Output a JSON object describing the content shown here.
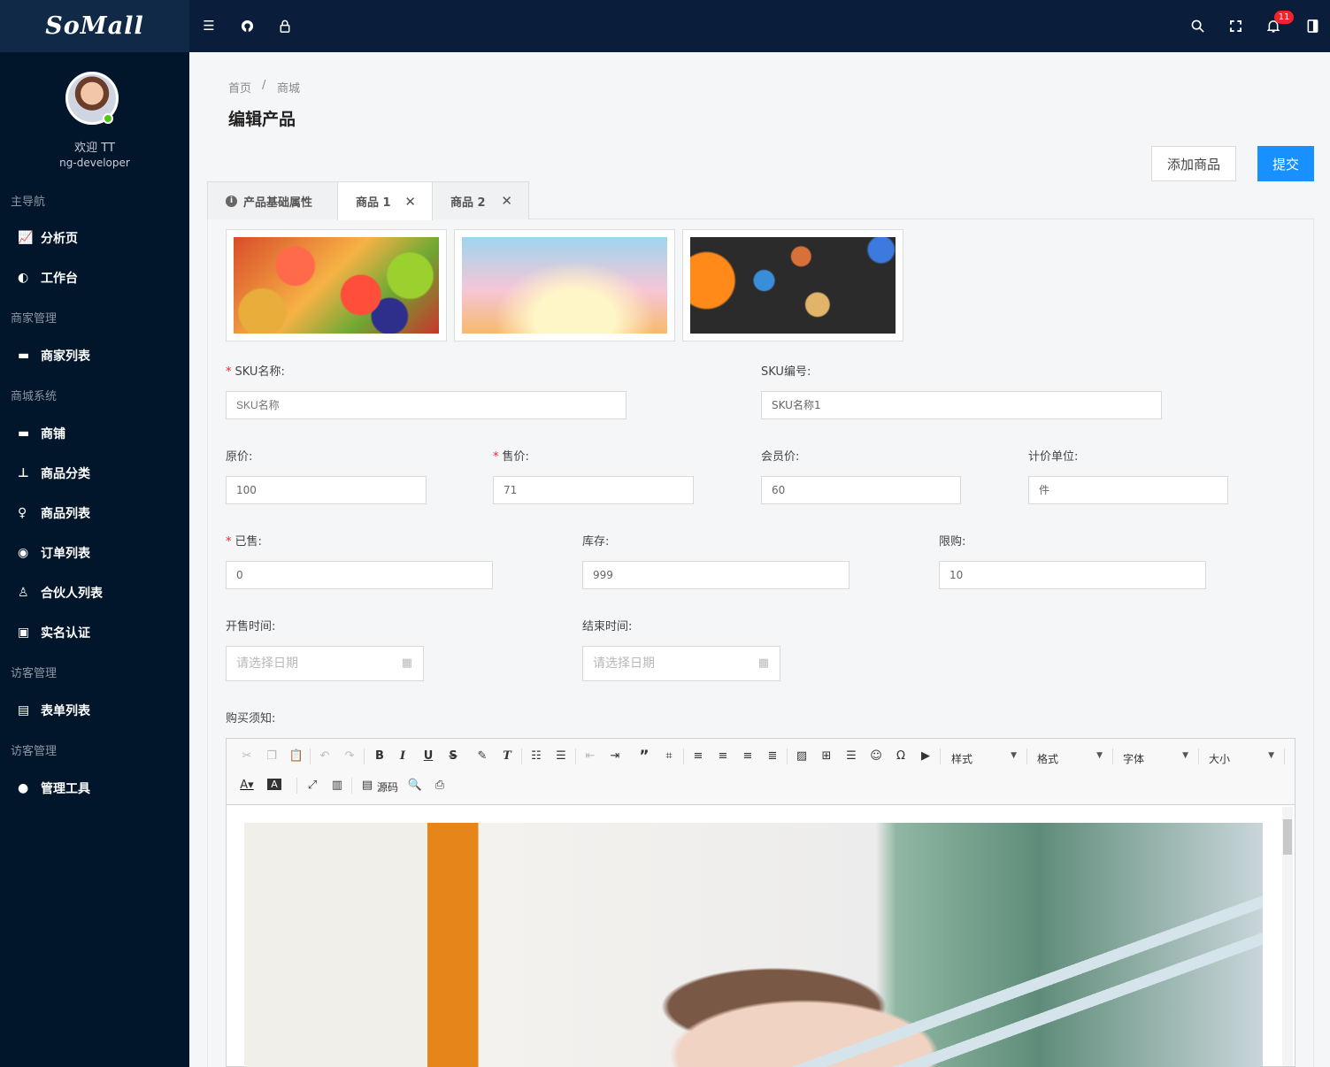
{
  "header": {
    "logo": "SoMall",
    "left_icons": [
      "menu-icon",
      "github-icon",
      "lock-icon"
    ],
    "right_icons": [
      "search-icon",
      "fullscreen-icon",
      "bell-icon",
      "panel-icon"
    ],
    "notification_count": "11"
  },
  "sidebar": {
    "welcome": "欢迎 TT",
    "username": "ng-developer",
    "groups": {
      "main": "主导航",
      "merchant": "商家管理",
      "mall": "商城系统",
      "visitor1": "访客管理",
      "visitor2": "访客管理"
    },
    "items": {
      "analysis": "分析页",
      "workbench": "工作台",
      "merchant_list": "商家列表",
      "shop": "商铺",
      "category": "商品分类",
      "product_list": "商品列表",
      "order_list": "订单列表",
      "partner_list": "合伙人列表",
      "realname": "实名认证",
      "form_list": "表单列表",
      "tools": "管理工具"
    }
  },
  "breadcrumb": {
    "home": "首页",
    "sep": "/",
    "current": "商城"
  },
  "page_title": "编辑产品",
  "actions": {
    "add": "添加商品",
    "submit": "提交"
  },
  "tabs": [
    {
      "label": "产品基础属性"
    },
    {
      "label": "商品 1"
    },
    {
      "label": "商品 2"
    }
  ],
  "tab_close": "✕",
  "form": {
    "sku_name": {
      "label": "SKU名称:",
      "placeholder": "SKU名称"
    },
    "sku_code": {
      "label": "SKU编号:",
      "value": "SKU名称1"
    },
    "original_price": {
      "label": "原价:",
      "value": "100"
    },
    "sale_price": {
      "label": "售价:",
      "value": "71"
    },
    "member_price": {
      "label": "会员价:",
      "value": "60"
    },
    "unit": {
      "label": "计价单位:",
      "value": "件"
    },
    "sold": {
      "label": "已售:",
      "value": "0"
    },
    "stock": {
      "label": "库存:",
      "value": "999"
    },
    "limit": {
      "label": "限购:",
      "value": "10"
    },
    "start_time": {
      "label": "开售时间:",
      "placeholder": "请选择日期"
    },
    "end_time": {
      "label": "结束时间:",
      "placeholder": "请选择日期"
    },
    "notice": {
      "label": "购买须知:"
    }
  },
  "editor": {
    "source_label": "源码",
    "combos": [
      "样式",
      "格式",
      "字体",
      "大小"
    ]
  },
  "colors": {
    "header": "#0a1e3b",
    "sidebar": "#02162b",
    "primary": "#1890ff",
    "required": "#f5222d"
  }
}
